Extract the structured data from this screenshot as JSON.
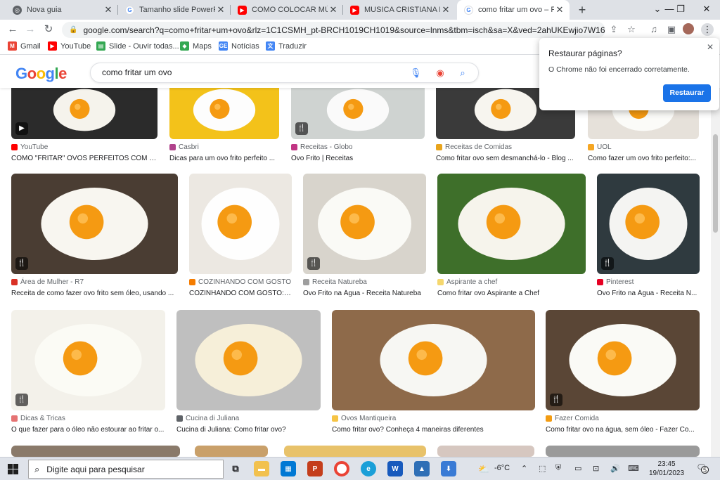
{
  "tabs": [
    {
      "title": "Nova guia",
      "icon": "chrome-icon",
      "color": "#5f6368"
    },
    {
      "title": "Tamanho slide PowerPoint",
      "icon": "google-icon",
      "color": "#4285f4"
    },
    {
      "title": "COMO COLOCAR MÚSICA",
      "icon": "youtube-icon",
      "color": "#ff0000"
    },
    {
      "title": "MUSICA CRISTIANA EN S",
      "icon": "youtube-icon",
      "color": "#ff0000"
    },
    {
      "title": "como fritar um ovo – Pesquisa",
      "icon": "google-icon",
      "color": "#4285f4"
    }
  ],
  "address_bar": {
    "url": "google.com/search?q=como+fritar+um+ovo&rlz=1C1CSMH_pt-BRCH1019CH1019&source=lnms&tbm=isch&sa=X&ved=2ahUKEwjio7W16NT8Ah..."
  },
  "bookmarks": [
    {
      "label": "Gmail",
      "icon": "gmail-icon",
      "color": "#ea4335"
    },
    {
      "label": "YouTube",
      "icon": "youtube-icon",
      "color": "#ff0000"
    },
    {
      "label": "Slide - Ouvir todas...",
      "icon": "slide-icon",
      "color": "#34a853"
    },
    {
      "label": "Maps",
      "icon": "maps-icon",
      "color": "#34a853"
    },
    {
      "label": "Notícias",
      "icon": "news-icon",
      "color": "#4285f4"
    },
    {
      "label": "Traduzir",
      "icon": "translate-icon",
      "color": "#4285f4"
    }
  ],
  "google": {
    "logo": "Google",
    "query": "como fritar um ovo"
  },
  "popup": {
    "title": "Restaurar páginas?",
    "message": "O Chrome não foi encerrado corretamente.",
    "button": "Restaurar"
  },
  "results": [
    {
      "source": "YouTube",
      "title": "COMO \"FRITAR\" OVOS PERFEITOS COM ÁG...",
      "color": "#ff0000",
      "badge": "▶"
    },
    {
      "source": "Casbri",
      "title": "Dicas para um ovo frito perfeito ...",
      "color": "#b0428b",
      "badge": ""
    },
    {
      "source": "Receitas - Globo",
      "title": "Ovo Frito | Receitas",
      "color": "#c13584",
      "badge": "🍴"
    },
    {
      "source": "Receitas de Comidas",
      "title": "Como fritar ovo sem desmanchá-lo - Blog ...",
      "color": "#e8a41c",
      "badge": ""
    },
    {
      "source": "UOL",
      "title": "Como fazer um ovo frito perfeito:...",
      "color": "#f5a623",
      "badge": ""
    },
    {
      "source": "Área de Mulher - R7",
      "title": "Receita de como fazer ovo frito sem óleo, usando ...",
      "color": "#d93025",
      "badge": "🍴"
    },
    {
      "source": "COZINHANDO COM GOSTO",
      "title": "COZINHANDO COM GOSTO: C...",
      "color": "#f57c00",
      "badge": ""
    },
    {
      "source": "Receita Natureba",
      "title": "Ovo Frito na Água - Receita Natureba",
      "color": "#9e9e9e",
      "badge": "🍴"
    },
    {
      "source": "Aspirante a chef",
      "title": "Como fritar ovo Aspirante a Chef",
      "color": "#f5d76e",
      "badge": ""
    },
    {
      "source": "Pinterest",
      "title": "Ovo Frito na Água - Receita N...",
      "color": "#e60023",
      "badge": "🍴"
    },
    {
      "source": "Dicas & Tricas",
      "title": "O que fazer para o óleo não estourar ao fritar o...",
      "color": "#e57373",
      "badge": "🍴"
    },
    {
      "source": "Cucina di Juliana",
      "title": "Cucina di Juliana: Como fritar ovo?",
      "color": "#5f6368",
      "badge": ""
    },
    {
      "source": "Ovos Mantiqueira",
      "title": "Como fritar ovo? Conheça 4 maneiras diferentes",
      "color": "#f6c445",
      "badge": ""
    },
    {
      "source": "Fazer Comida",
      "title": "Como fritar ovo na água, sem óleo - Fazer Co...",
      "color": "#f39c12",
      "badge": "🍴"
    }
  ],
  "taskbar": {
    "search_placeholder": "Digite aqui para pesquisar",
    "weather": "-6°C",
    "time": "23:45",
    "date": "19/01/2023",
    "notifications": "5"
  },
  "colors": {
    "accent": "#1a73e8",
    "google_blue": "#4285f4",
    "google_red": "#ea4335",
    "google_yellow": "#fbbc05",
    "google_green": "#34a853"
  }
}
